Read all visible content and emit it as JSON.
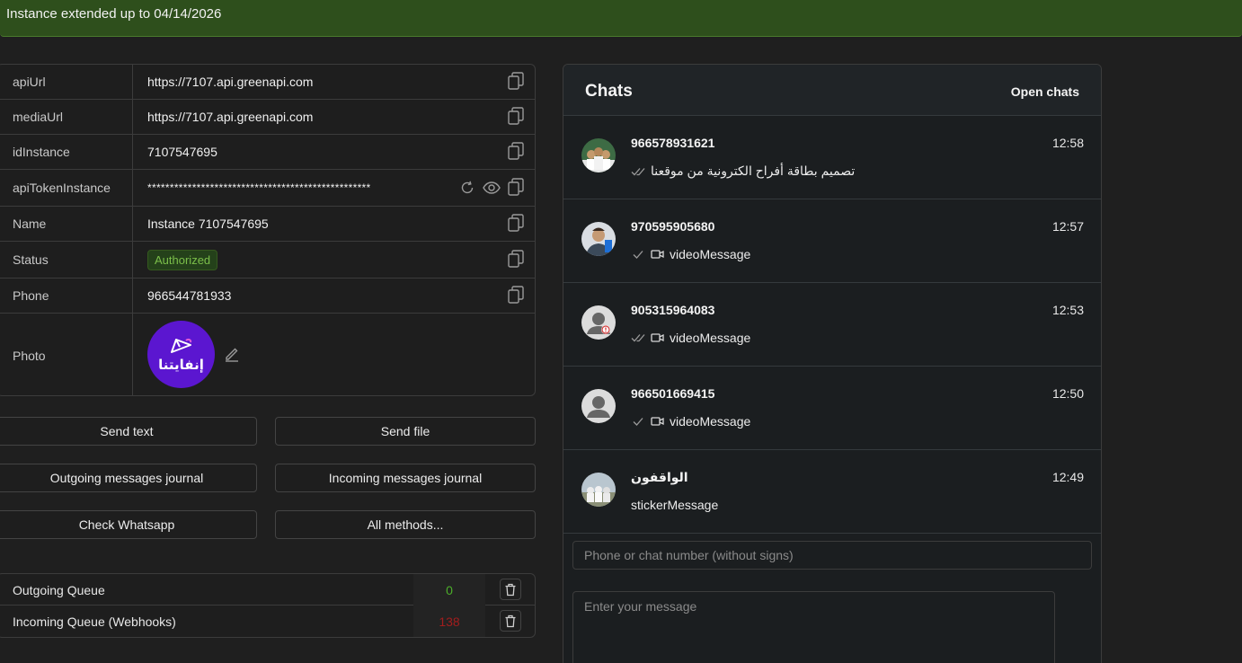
{
  "banner": {
    "text": "Instance extended up to 04/14/2026"
  },
  "info": {
    "rows": [
      {
        "label": "apiUrl",
        "value": "https://7107.api.greenapi.com"
      },
      {
        "label": "mediaUrl",
        "value": "https://7107.api.greenapi.com"
      },
      {
        "label": "idInstance",
        "value": "7107547695"
      },
      {
        "label": "apiTokenInstance",
        "value": "**************************************************"
      },
      {
        "label": "Name",
        "value": "Instance 7107547695"
      },
      {
        "label": "Status",
        "value": "Authorized"
      },
      {
        "label": "Phone",
        "value": "966544781933"
      },
      {
        "label": "Photo",
        "value": "إنفايتنا"
      }
    ]
  },
  "actions": {
    "send_text": "Send text",
    "send_file": "Send file",
    "outgoing_journal": "Outgoing messages journal",
    "incoming_journal": "Incoming messages journal",
    "check_whatsapp": "Check Whatsapp",
    "all_methods": "All methods..."
  },
  "queues": [
    {
      "label": "Outgoing Queue",
      "value": "0",
      "color": "#4caf2a"
    },
    {
      "label": "Incoming Queue (Webhooks)",
      "value": "138",
      "color": "#a11d1d"
    }
  ],
  "chats": {
    "title": "Chats",
    "open_label": "Open chats",
    "items": [
      {
        "number": "966578931621",
        "time": "12:58",
        "message": "تصميم بطاقة أفراح الكترونية من موقعنا",
        "status": "read",
        "media": ""
      },
      {
        "number": "970595905680",
        "time": "12:57",
        "message": "videoMessage",
        "status": "sent",
        "media": "video"
      },
      {
        "number": "905315964083",
        "time": "12:53",
        "message": "videoMessage",
        "status": "read",
        "media": "video"
      },
      {
        "number": "966501669415",
        "time": "12:50",
        "message": "videoMessage",
        "status": "sent",
        "media": "video"
      },
      {
        "number": "الواقفون",
        "time": "12:49",
        "message": "stickerMessage",
        "status": "",
        "media": ""
      }
    ],
    "phone_placeholder": "Phone or chat number (without signs)",
    "message_placeholder": "Enter your message"
  },
  "colors": {
    "banner": "#2e4f1c",
    "status_badge": "#7bbf4a",
    "photo_bg": "#5b16d0"
  }
}
